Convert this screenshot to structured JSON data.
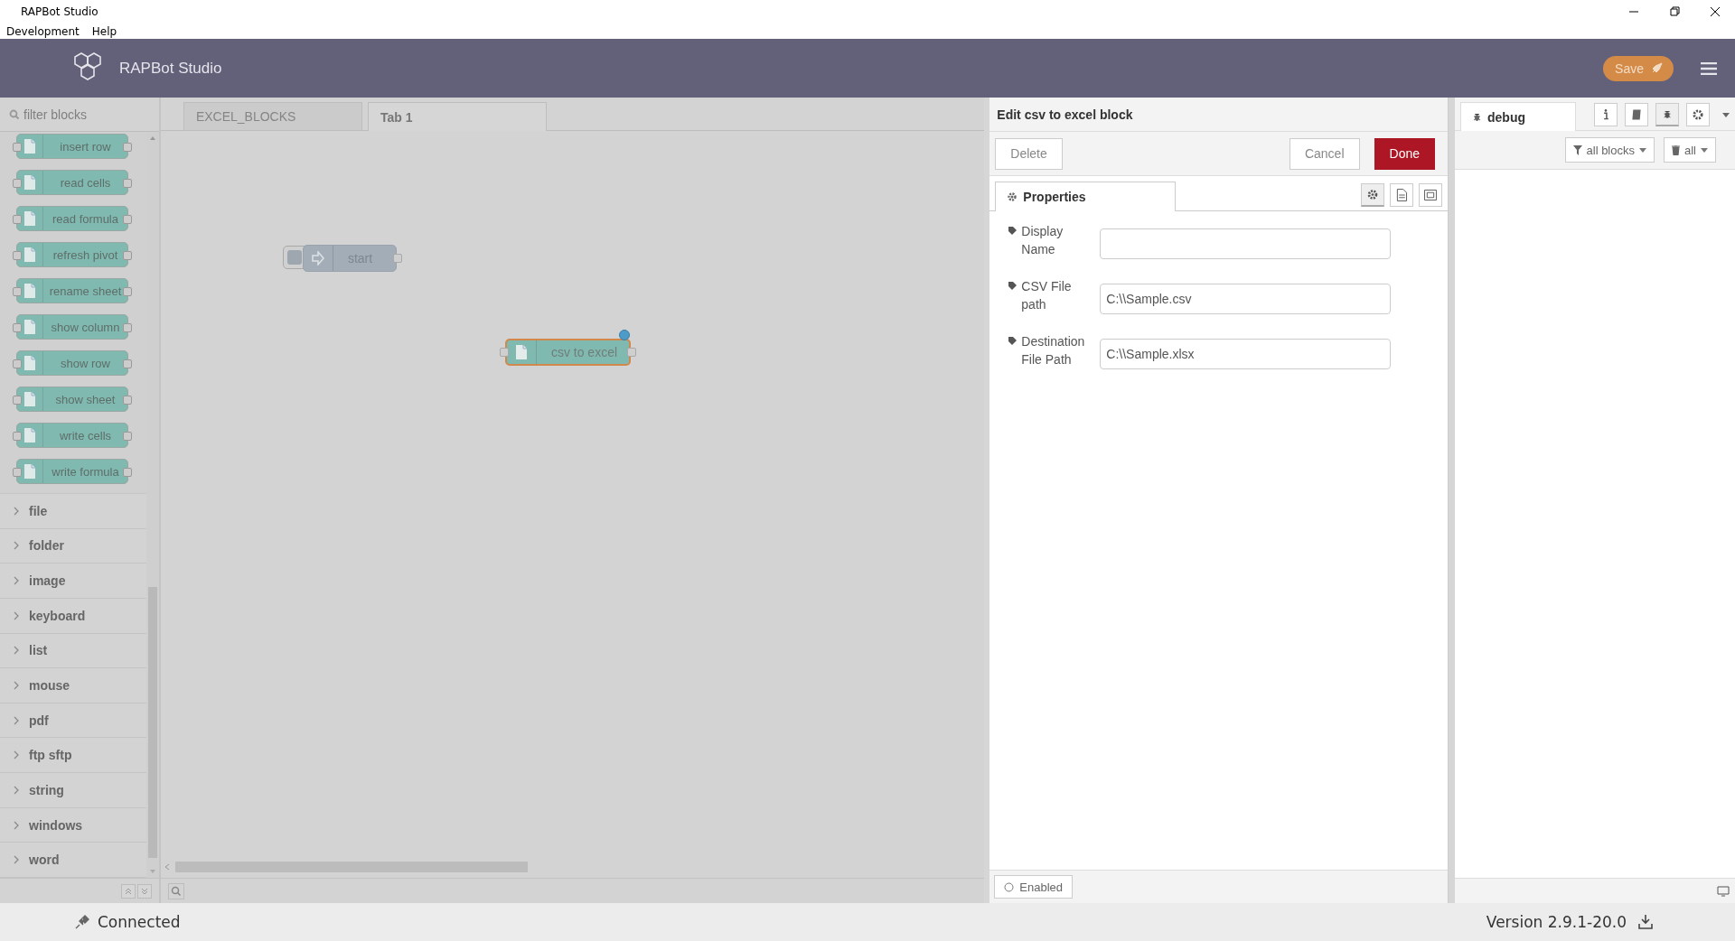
{
  "window": {
    "title": "RAPBot Studio"
  },
  "menu": [
    {
      "label": "Development"
    },
    {
      "label": "Help"
    }
  ],
  "header": {
    "title": "RAPBot Studio",
    "save_button": "Save"
  },
  "palette": {
    "search": {
      "placeholder": "filter blocks"
    },
    "blocks": [
      {
        "label": "insert row"
      },
      {
        "label": "read cells"
      },
      {
        "label": "read formula"
      },
      {
        "label": "refresh pivot"
      },
      {
        "label": "rename sheet"
      },
      {
        "label": "show column"
      },
      {
        "label": "show row"
      },
      {
        "label": "show sheet"
      },
      {
        "label": "write cells"
      },
      {
        "label": "write formula"
      }
    ],
    "categories": [
      {
        "label": "file",
        "expanded": false
      },
      {
        "label": "folder",
        "expanded": false
      },
      {
        "label": "image",
        "expanded": false
      },
      {
        "label": "keyboard",
        "expanded": false
      },
      {
        "label": "list",
        "expanded": false
      },
      {
        "label": "mouse",
        "expanded": false
      },
      {
        "label": "pdf",
        "expanded": false
      },
      {
        "label": "ftp sftp",
        "expanded": false
      },
      {
        "label": "string",
        "expanded": false
      },
      {
        "label": "windows",
        "expanded": false
      },
      {
        "label": "word",
        "expanded": false
      }
    ]
  },
  "workspace": {
    "tabs": [
      {
        "label": "EXCEL_BLOCKS",
        "selected": false
      },
      {
        "label": "Tab 1",
        "selected": true
      }
    ],
    "nodes": [
      {
        "label": "start",
        "kind": "inject",
        "selected": false,
        "changed": false
      },
      {
        "label": "csv to excel",
        "kind": "file",
        "selected": true,
        "changed": true
      }
    ]
  },
  "editor": {
    "title": "Edit csv to excel block",
    "delete_button": "Delete",
    "cancel_button": "Cancel",
    "done_button": "Done",
    "tabs": [
      {
        "label": "Properties",
        "selected": true
      }
    ],
    "fields": [
      {
        "label": "Display Name"
      },
      {
        "label": "CSV File path",
        "value": "C:\\\\Sample.csv"
      },
      {
        "label": "Destination File Path",
        "value": "C:\\\\Sample.xlsx"
      }
    ],
    "enabled_button": "Enabled"
  },
  "sidebar": {
    "tabs": [
      {
        "label": "debug",
        "selected": true
      }
    ],
    "filter_button": "all blocks",
    "clear_button": "all"
  },
  "status_bar": {
    "connection": "Connected",
    "version": "Version 2.9.1-20.0"
  }
}
